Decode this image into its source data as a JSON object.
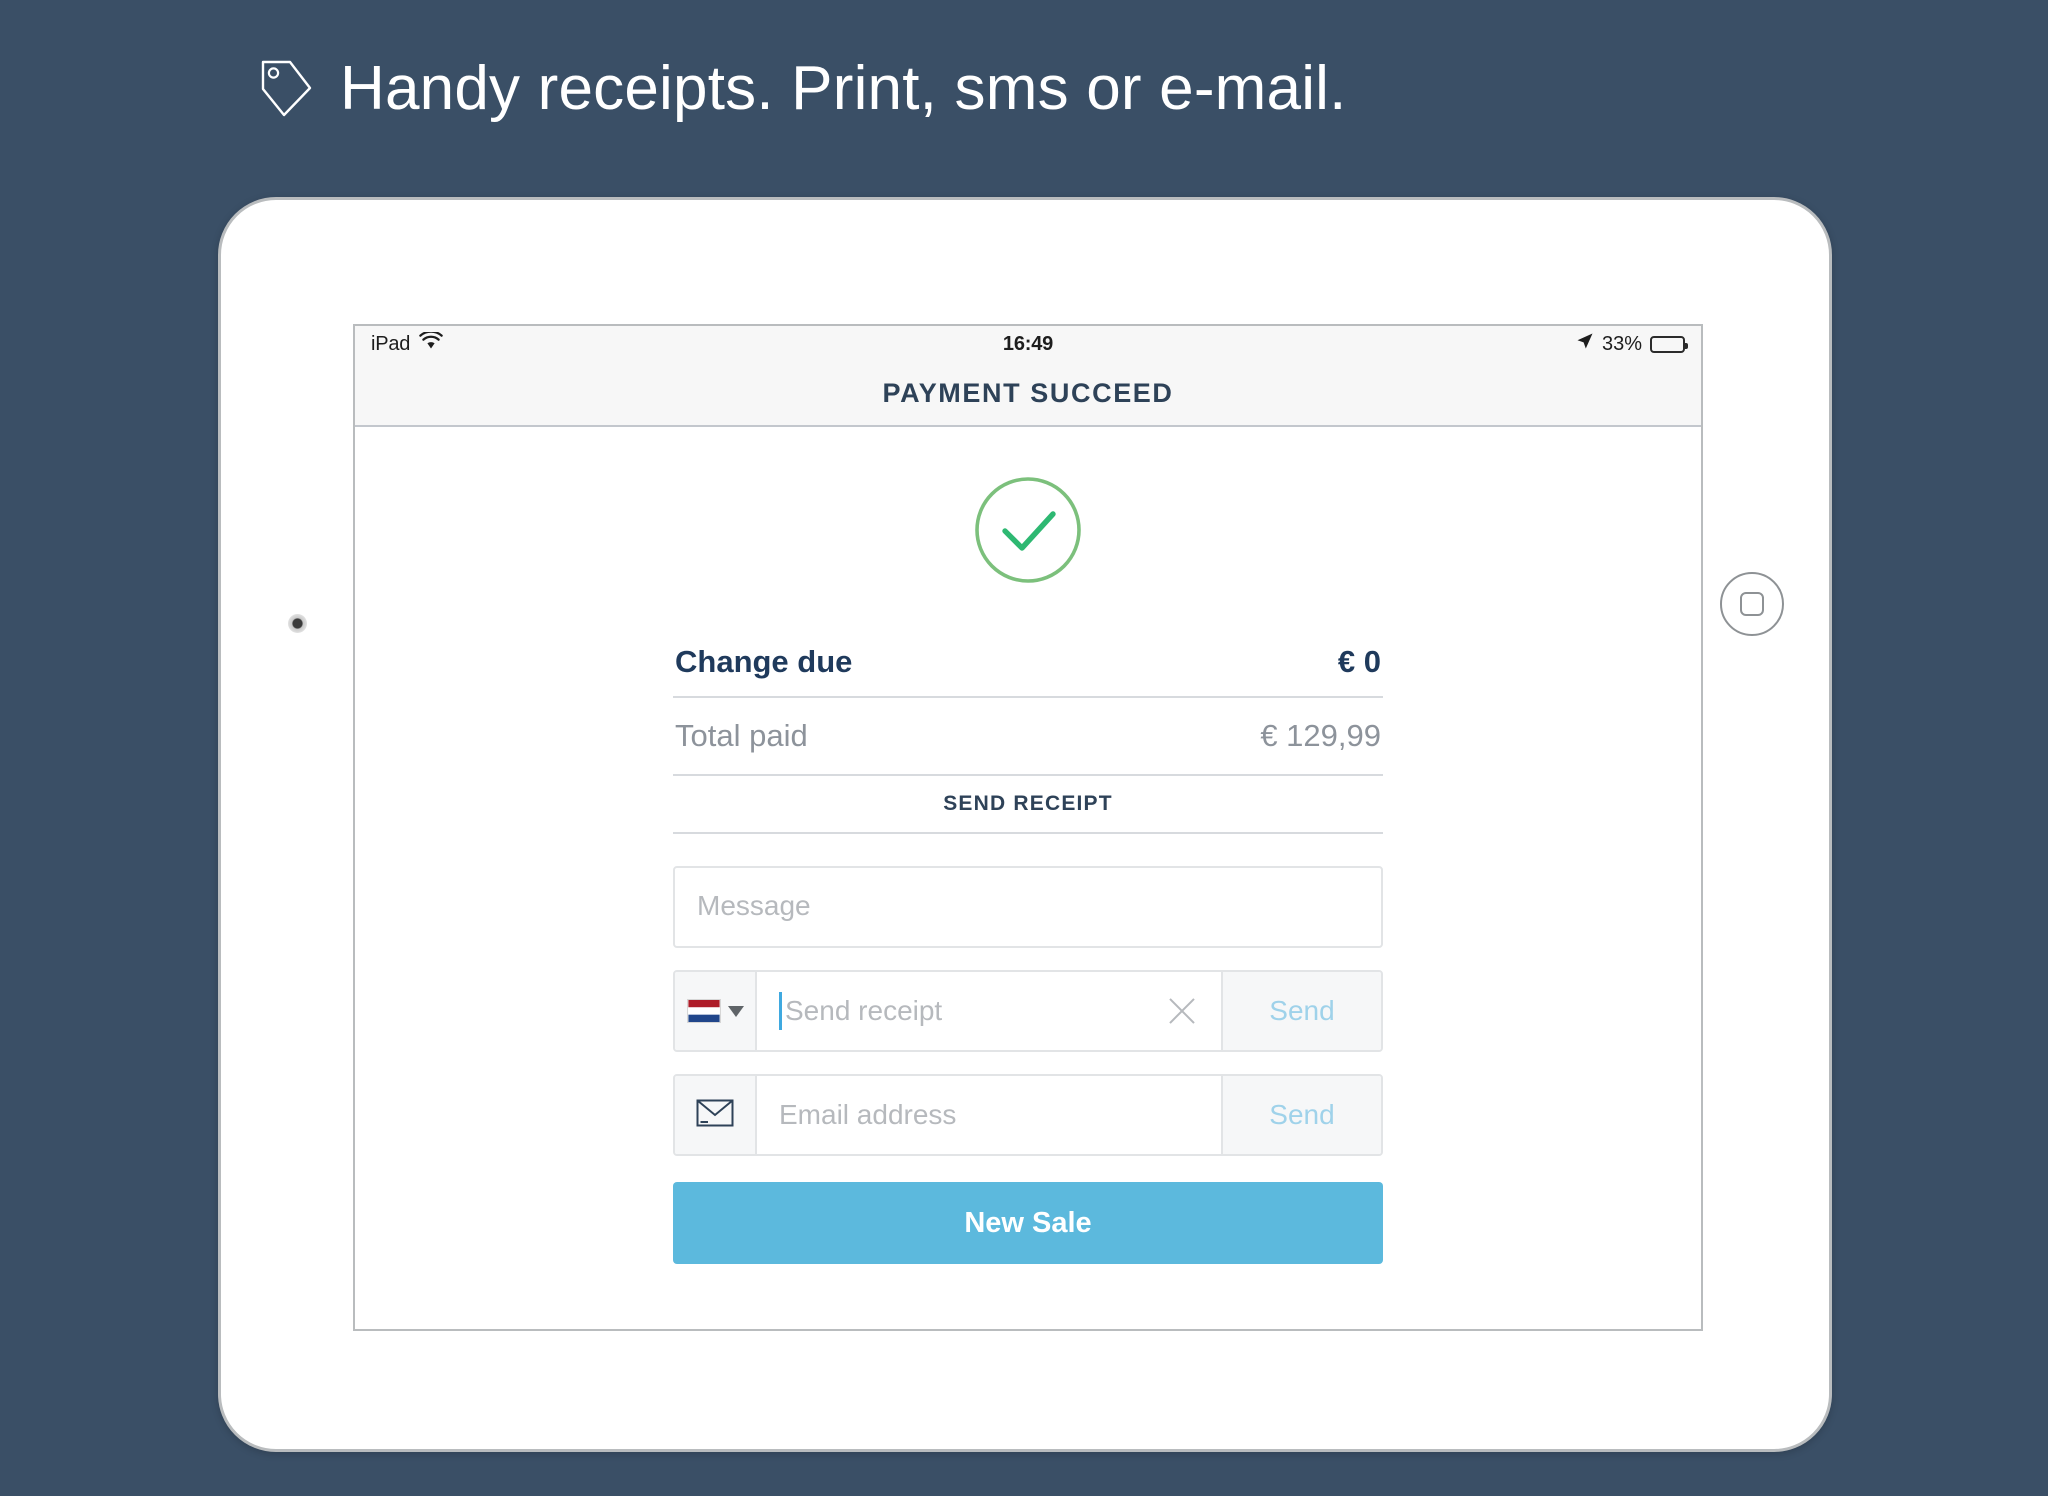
{
  "page": {
    "background_color": "#3a4f66",
    "headline": "Handy receipts. Print, sms or e-mail.",
    "headline_icon": "tag-icon"
  },
  "device": {
    "type": "ipad",
    "camera_icon": "camera-dot",
    "home_button_icon": "home-square-icon"
  },
  "status_bar": {
    "carrier": "iPad",
    "wifi_icon": "wifi-icon",
    "time": "16:49",
    "location_icon": "location-arrow-icon",
    "battery_percent": "33%",
    "battery_icon": "battery-icon",
    "battery_level": 33
  },
  "nav_bar": {
    "title": "PAYMENT SUCCEED",
    "title_color": "#2e4258"
  },
  "success": {
    "icon": "check-circle-icon",
    "circle_color": "#7cc07c",
    "check_color": "#2eb872"
  },
  "amounts": [
    {
      "id": "change-due",
      "label": "Change due",
      "value": "€ 0",
      "emphasis": "strong",
      "color": "#1f3a5c"
    },
    {
      "id": "total-paid",
      "label": "Total paid",
      "value": "€ 129,99",
      "emphasis": "muted",
      "color": "#8d939b"
    }
  ],
  "send_receipt": {
    "section_label": "SEND RECEIPT",
    "message_field": {
      "placeholder": "Message",
      "value": ""
    },
    "sms_field": {
      "country_flag": "netherlands-flag-icon",
      "dropdown_icon": "chevron-down-icon",
      "placeholder": "Send receipt",
      "value": "",
      "clear_icon": "close-x-icon",
      "send_label": "Send",
      "send_color": "#9fd2ea"
    },
    "email_field": {
      "icon": "envelope-icon",
      "placeholder": "Email address",
      "value": "",
      "send_label": "Send",
      "send_color": "#9fd2ea"
    }
  },
  "primary_action": {
    "label": "New Sale",
    "color": "#5cb9dd",
    "text_color": "#ffffff"
  }
}
